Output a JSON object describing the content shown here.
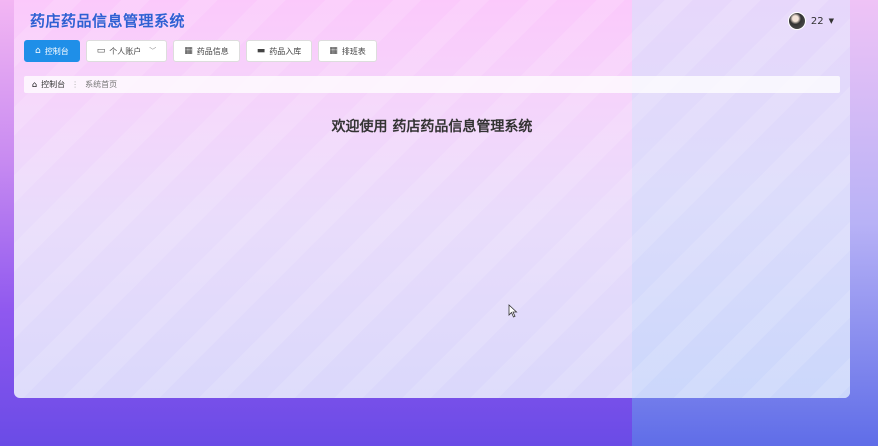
{
  "app": {
    "title": "药店药品信息管理系统"
  },
  "user": {
    "name": "22"
  },
  "toolbar": [
    {
      "label": "控制台",
      "icon": "home-icon",
      "active": true
    },
    {
      "label": "个人账户",
      "icon": "card-icon",
      "dropdown": true
    },
    {
      "label": "药品信息",
      "icon": "grid-icon"
    },
    {
      "label": "药品入库",
      "icon": "box-icon"
    },
    {
      "label": "排班表",
      "icon": "grid-icon"
    }
  ],
  "breadcrumb": {
    "home": "控制台",
    "current": "系统首页"
  },
  "main": {
    "welcome": "欢迎使用 药店药品信息管理系统"
  },
  "colors": {
    "primary": "#1f8fe8",
    "title": "#2f5fd3"
  }
}
